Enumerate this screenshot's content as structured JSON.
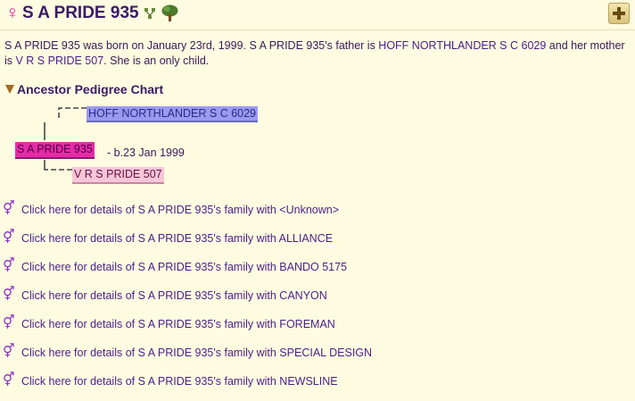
{
  "header": {
    "gender_icon": "♀",
    "title": "S A PRIDE 935",
    "icons": [
      "family-group-icon",
      "tree-icon"
    ],
    "action_icon": "plus-icon"
  },
  "bio": {
    "part1": "S A PRIDE 935 was born on January 23rd, 1999.  S A PRIDE 935's father is ",
    "father_link": "HOFF NORTHLANDER S C 6029",
    "part2": " and her mother is ",
    "mother_link": "V R S PRIDE 507",
    "part3": ".  She is an only child."
  },
  "pedigree": {
    "section_title": "Ancestor Pedigree Chart",
    "father": "HOFF NORTHLANDER S C 6029",
    "self": "S A PRIDE 935",
    "self_born": " - b.23 Jan 1999",
    "mother": "V R S PRIDE 507",
    "colors": {
      "father_box": "#9a9af0",
      "self_box": "#e62ba8",
      "mother_box": "#f6c6d8"
    }
  },
  "families": {
    "icon": "⚥",
    "items": [
      "Click here for details of S A PRIDE 935's family with <Unknown>",
      "Click here for details of S A PRIDE 935's family with ALLIANCE",
      "Click here for details of S A PRIDE 935's family with BANDO 5175",
      "Click here for details of S A PRIDE 935's family with CANYON",
      "Click here for details of S A PRIDE 935's family with FOREMAN",
      "Click here for details of S A PRIDE 935's family with SPECIAL DESIGN",
      "Click here for details of S A PRIDE 935's family with NEWSLINE"
    ]
  }
}
